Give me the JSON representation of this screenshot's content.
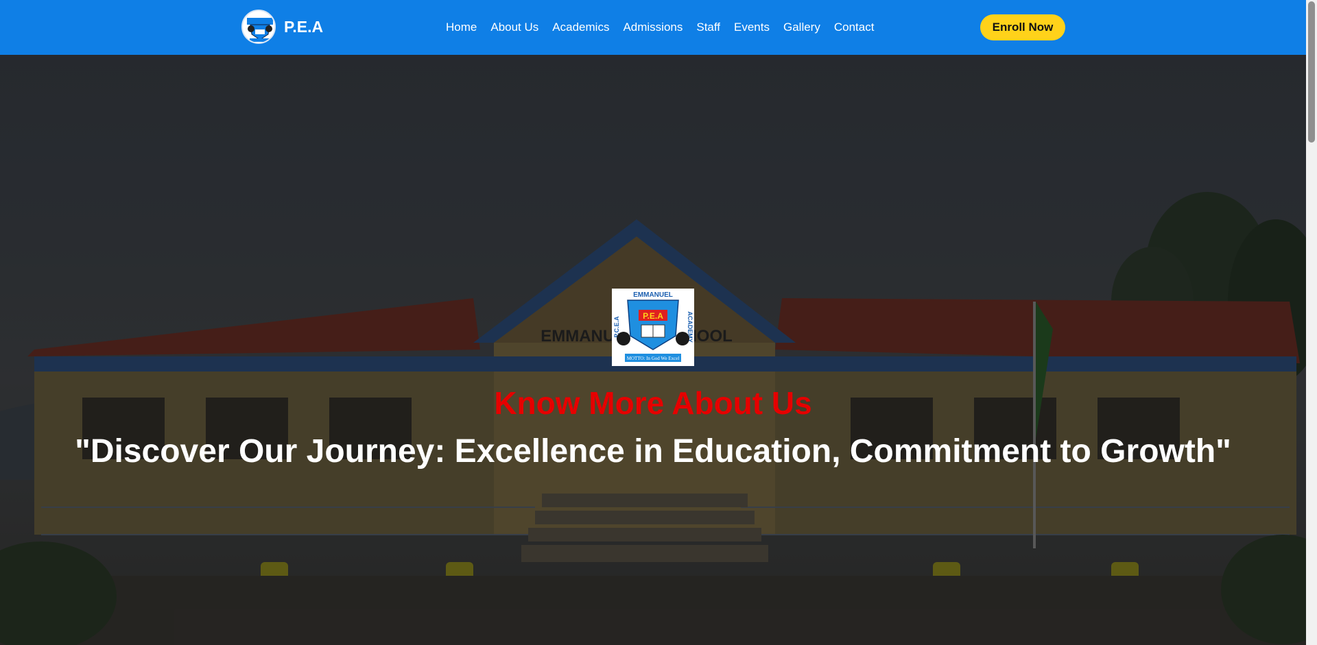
{
  "brand": {
    "name": "P.E.A"
  },
  "nav": {
    "links": [
      "Home",
      "About Us",
      "Academics",
      "Admissions",
      "Staff",
      "Events",
      "Gallery",
      "Contact"
    ],
    "cta": "Enroll Now"
  },
  "hero": {
    "emblem_text": {
      "top": "EMMANUEL",
      "left": "P.C.E.A",
      "right": "ACADEMY",
      "center": "P.E.A",
      "motto": "MOTTO: In God We Excel"
    },
    "kicker": "Know More About Us",
    "tagline": "\"Discover Our Journey: Excellence in Education, Commitment to Growth\""
  },
  "colors": {
    "nav_bg": "#0f7fe6",
    "cta_bg": "#ffd21a",
    "kicker": "#e60000"
  }
}
